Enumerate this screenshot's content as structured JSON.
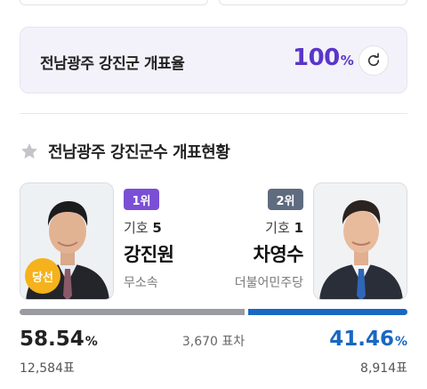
{
  "tally": {
    "title": "전남광주 강진군 개표율",
    "rate_value": "100",
    "rate_unit": "%"
  },
  "section": {
    "title": "전남광주 강진군수 개표현황"
  },
  "candidates": [
    {
      "rank": "1위",
      "number_label": "기호",
      "number": "5",
      "name": "강진원",
      "party": "무소속",
      "badge": "당선",
      "percent": "58.54",
      "percent_unit": "%",
      "votes": "12,584표",
      "vote_share": 58.54
    },
    {
      "rank": "2위",
      "number_label": "기호",
      "number": "1",
      "name": "차영수",
      "party": "더불어민주당",
      "percent": "41.46",
      "percent_unit": "%",
      "votes": "8,914표",
      "vote_share": 41.46
    }
  ],
  "difference": "3,670 표차",
  "colors": {
    "rate_accent": "#5b35c9",
    "rank1": "#7a4fd6",
    "rank2": "#5f6b7e",
    "winner_badge": "#f5b21c",
    "loser_bar": "#1967c2",
    "winner_bar": "#9a9aa2"
  },
  "icons": {
    "refresh": "refresh-icon",
    "star": "star-icon"
  }
}
